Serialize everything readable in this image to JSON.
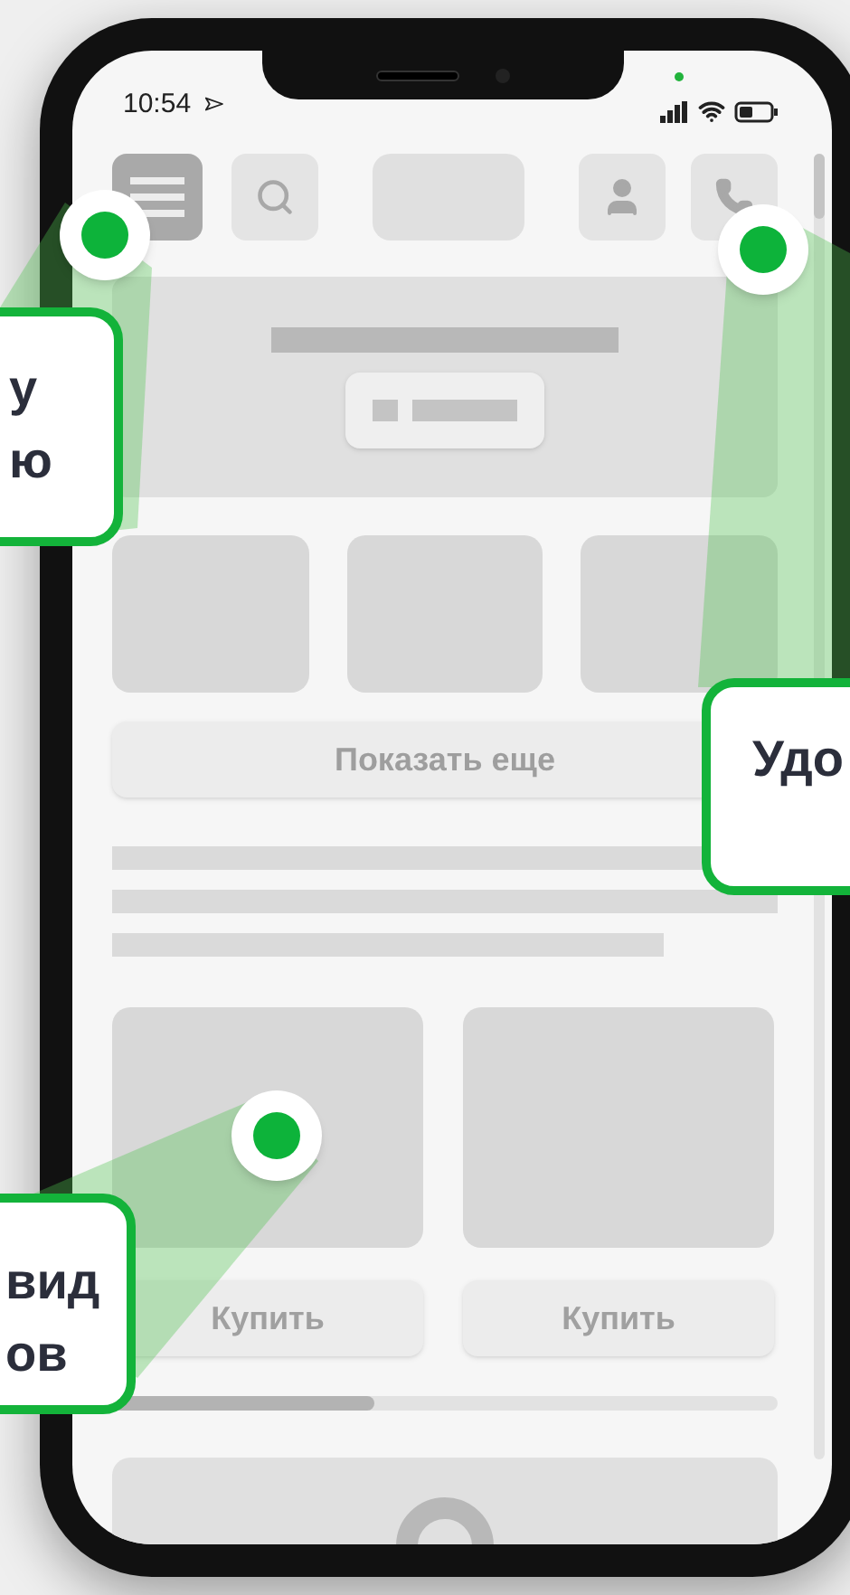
{
  "status_bar": {
    "time": "10:54"
  },
  "show_more": {
    "label": "Показать еще"
  },
  "products": [
    {
      "button": "Купить"
    },
    {
      "button": "Купить"
    }
  ],
  "callouts": [
    {
      "lines": [
        "у",
        "ю"
      ]
    },
    {
      "lines": [
        "Удо"
      ]
    },
    {
      "lines": [
        "вид",
        "ов"
      ]
    }
  ]
}
